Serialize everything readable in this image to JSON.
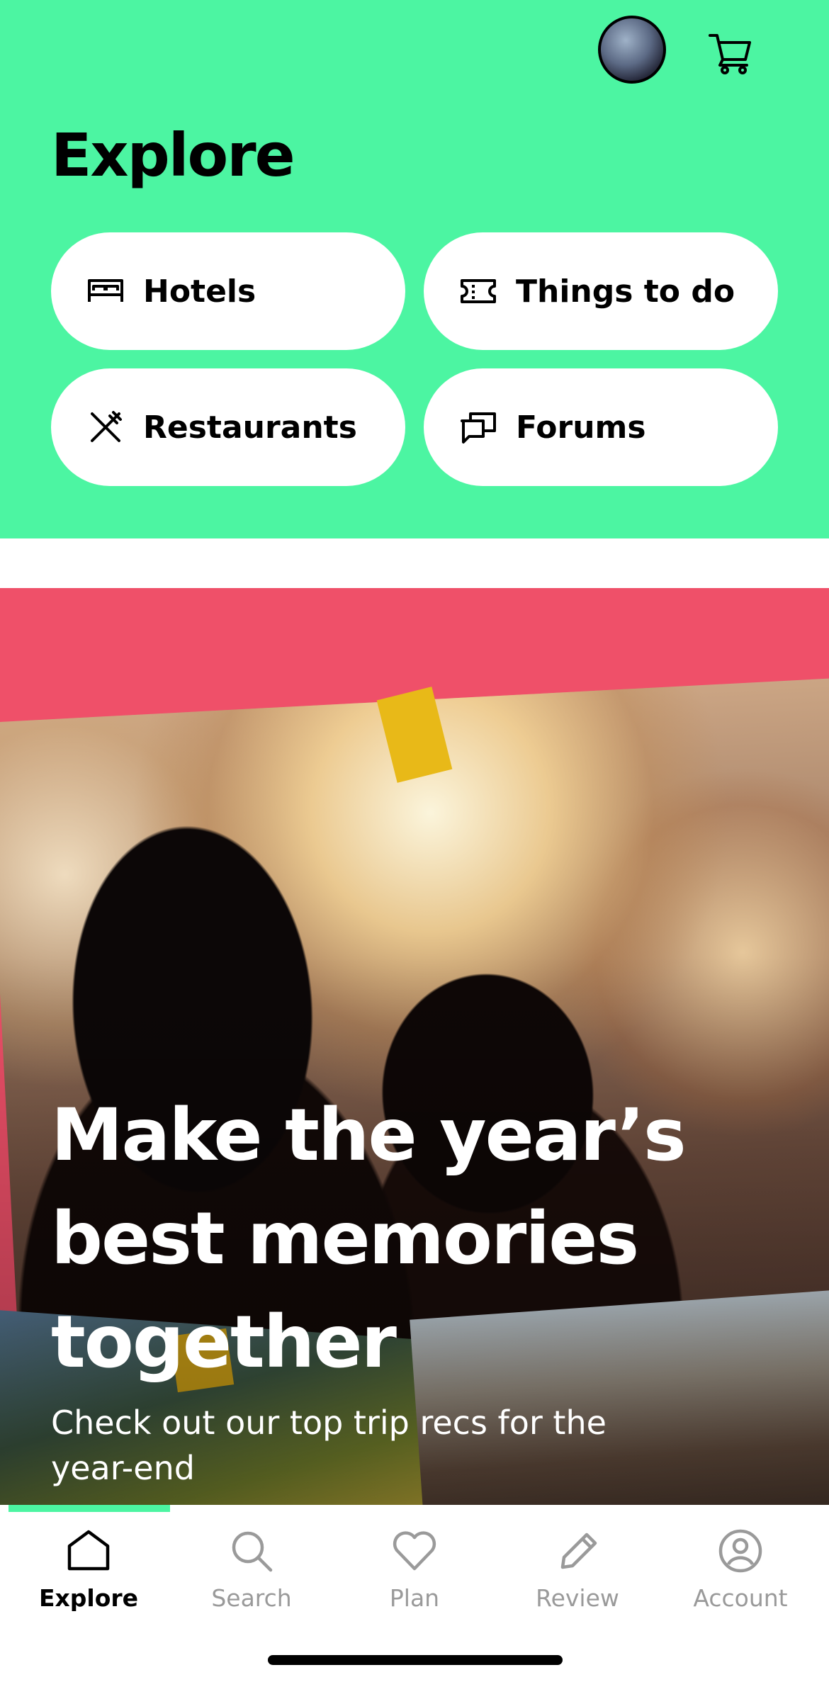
{
  "header": {
    "title": "Explore",
    "avatar": "user-avatar",
    "cart_icon": "cart-icon",
    "categories": [
      {
        "label": "Hotels",
        "icon": "bed-icon"
      },
      {
        "label": "Things to do",
        "icon": "ticket-icon"
      },
      {
        "label": "Restaurants",
        "icon": "fork-knife-icon"
      },
      {
        "label": "Forums",
        "icon": "chat-bubbles-icon"
      }
    ]
  },
  "promo": {
    "headline": "Make the year’s best memories together",
    "subline": "Check out our top trip recs for the year-end",
    "background_color": "#ef5069"
  },
  "tabbar": {
    "tabs": [
      {
        "label": "Explore",
        "icon": "home-icon",
        "active": true
      },
      {
        "label": "Search",
        "icon": "search-icon",
        "active": false
      },
      {
        "label": "Plan",
        "icon": "heart-icon",
        "active": false
      },
      {
        "label": "Review",
        "icon": "pencil-icon",
        "active": false
      },
      {
        "label": "Account",
        "icon": "account-icon",
        "active": false
      }
    ]
  },
  "colors": {
    "accent": "#4cf5a2",
    "promo": "#ef5069",
    "inactive_text": "#9a9a9a"
  }
}
